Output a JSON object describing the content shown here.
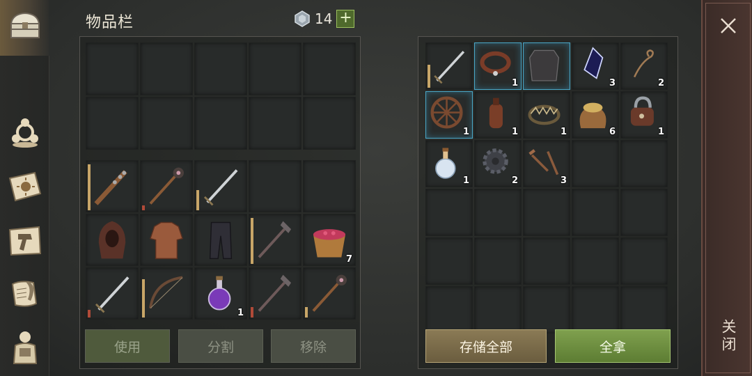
{
  "inventory": {
    "title": "物品栏",
    "gem_count": "14",
    "plus_label": "+",
    "buttons": {
      "use": "使用",
      "split": "分割",
      "remove": "移除"
    },
    "grid": [
      {
        "item": "spiked-club",
        "durability": 0.9
      },
      {
        "item": "morning-star",
        "durability": 0.1,
        "dur_color": "red"
      },
      {
        "item": "sword",
        "durability": 0.4
      },
      null,
      null,
      {
        "item": "hood"
      },
      {
        "item": "padded-jacket"
      },
      {
        "item": "trousers"
      },
      {
        "item": "spear-mace",
        "durability": 0.9
      },
      {
        "item": "berry-bowl",
        "count": "7"
      },
      {
        "item": "sword",
        "durability": 0.15,
        "dur_color": "red"
      },
      {
        "item": "bow",
        "durability": 0.75
      },
      {
        "item": "purple-potion",
        "count": "1"
      },
      {
        "item": "spear-mace",
        "durability": 0.2,
        "dur_color": "red"
      },
      {
        "item": "morning-star",
        "durability": 0.2
      }
    ]
  },
  "container": {
    "buttons": {
      "store_all": "存储全部",
      "take_all": "全拿"
    },
    "grid": [
      {
        "item": "sword",
        "durability": 0.5
      },
      {
        "item": "collar",
        "count": "1",
        "selected": true
      },
      {
        "item": "chainmail",
        "selected": true
      },
      {
        "item": "crystal",
        "count": "3"
      },
      {
        "item": "rope",
        "count": "2"
      },
      {
        "item": "wheel",
        "count": "1",
        "selected": true
      },
      {
        "item": "leather-bottle",
        "count": "1"
      },
      {
        "item": "bear-trap",
        "count": "1"
      },
      {
        "item": "seed-sack",
        "count": "6"
      },
      {
        "item": "padlock",
        "count": "1"
      },
      {
        "item": "honey-flask",
        "count": "1"
      },
      {
        "item": "gear",
        "count": "2"
      },
      {
        "item": "nails",
        "count": "3"
      }
    ]
  },
  "close": {
    "label": "关闭"
  },
  "sidebar": {
    "items": [
      "chest-icon",
      "clan-icon",
      "sun-book-icon",
      "crafting-hammer-icon",
      "scroll-quill-icon",
      "character-icon"
    ]
  },
  "colors": {
    "accent_gold": "#c8a668",
    "take_green": "#7fa04e",
    "select_blue": "#4aa8c8"
  }
}
